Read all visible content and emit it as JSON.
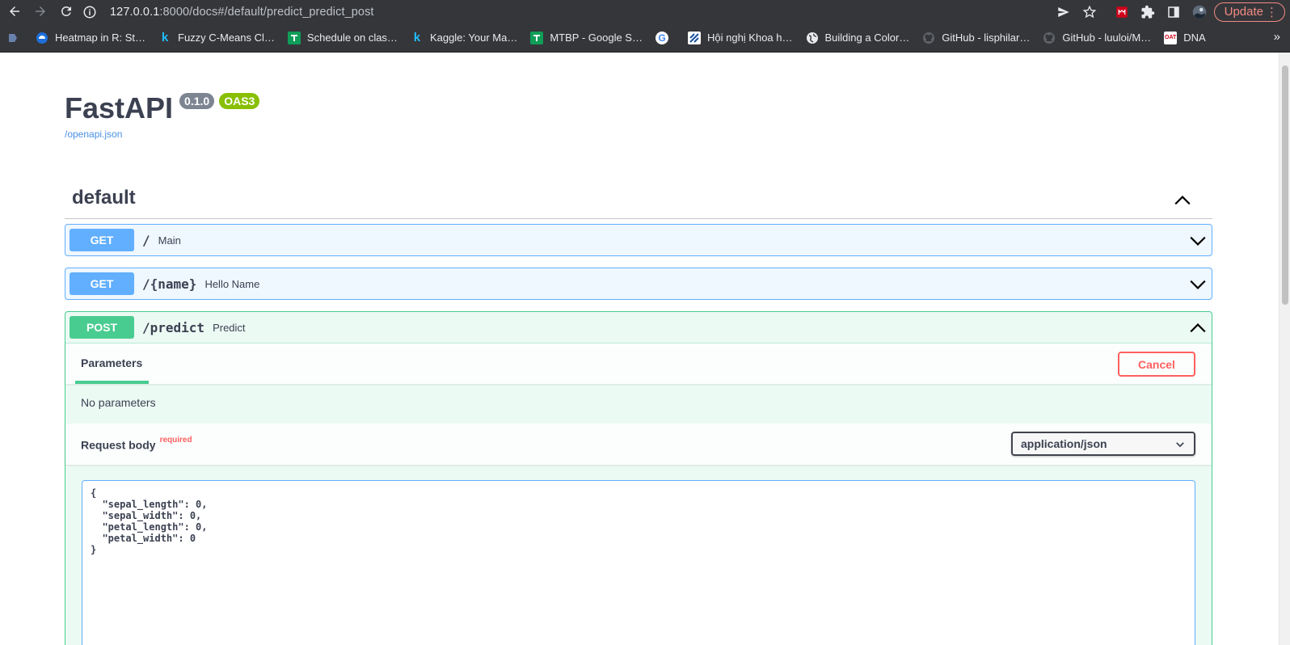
{
  "browser": {
    "url_host": "127.0.0.1",
    "url_rest": ":8000/docs#/default/predict_predict_post",
    "update_label": "Update",
    "bookmarks": [
      {
        "label": "Heatmap in R: St…",
        "icon": "heatmap-site-icon"
      },
      {
        "label": "Fuzzy C-Means Cl…",
        "icon": "kaggle-icon"
      },
      {
        "label": "Schedule on clas…",
        "icon": "google-sheets-icon"
      },
      {
        "label": "Kaggle: Your Ma…",
        "icon": "kaggle-icon"
      },
      {
        "label": "MTBP - Google S…",
        "icon": "google-sheets-icon"
      },
      {
        "label": "",
        "icon": "google-icon"
      },
      {
        "label": "Hội nghị Khoa h…",
        "icon": "conference-icon"
      },
      {
        "label": "Building a Color…",
        "icon": "globe-icon"
      },
      {
        "label": "GitHub - lisphilar…",
        "icon": "github-icon"
      },
      {
        "label": "GitHub - luuloi/M…",
        "icon": "github-icon"
      },
      {
        "label": "DNA",
        "icon": "dna-site-icon"
      }
    ]
  },
  "api": {
    "title": "FastAPI",
    "version": "0.1.0",
    "oas": "OAS3",
    "spec_link": "/openapi.json"
  },
  "section": {
    "title": "default"
  },
  "operations": [
    {
      "method": "GET",
      "path": "/",
      "summary": "Main"
    },
    {
      "method": "GET",
      "path": "/{name}",
      "summary": "Hello Name"
    },
    {
      "method": "POST",
      "path": "/predict",
      "summary": "Predict"
    }
  ],
  "post_panel": {
    "tab_label": "Parameters",
    "cancel_label": "Cancel",
    "no_params": "No parameters",
    "request_body_label": "Request body",
    "required_label": "required",
    "content_type": "application/json",
    "body_text": "{\n  \"sepal_length\": 0,\n  \"sepal_width\": 0,\n  \"petal_length\": 0,\n  \"petal_width\": 0\n}"
  },
  "colors": {
    "get": "#61affe",
    "post": "#49cc90",
    "cancel": "#ff6060",
    "badge_version": "#7d8492",
    "badge_oas": "#89bf04"
  }
}
